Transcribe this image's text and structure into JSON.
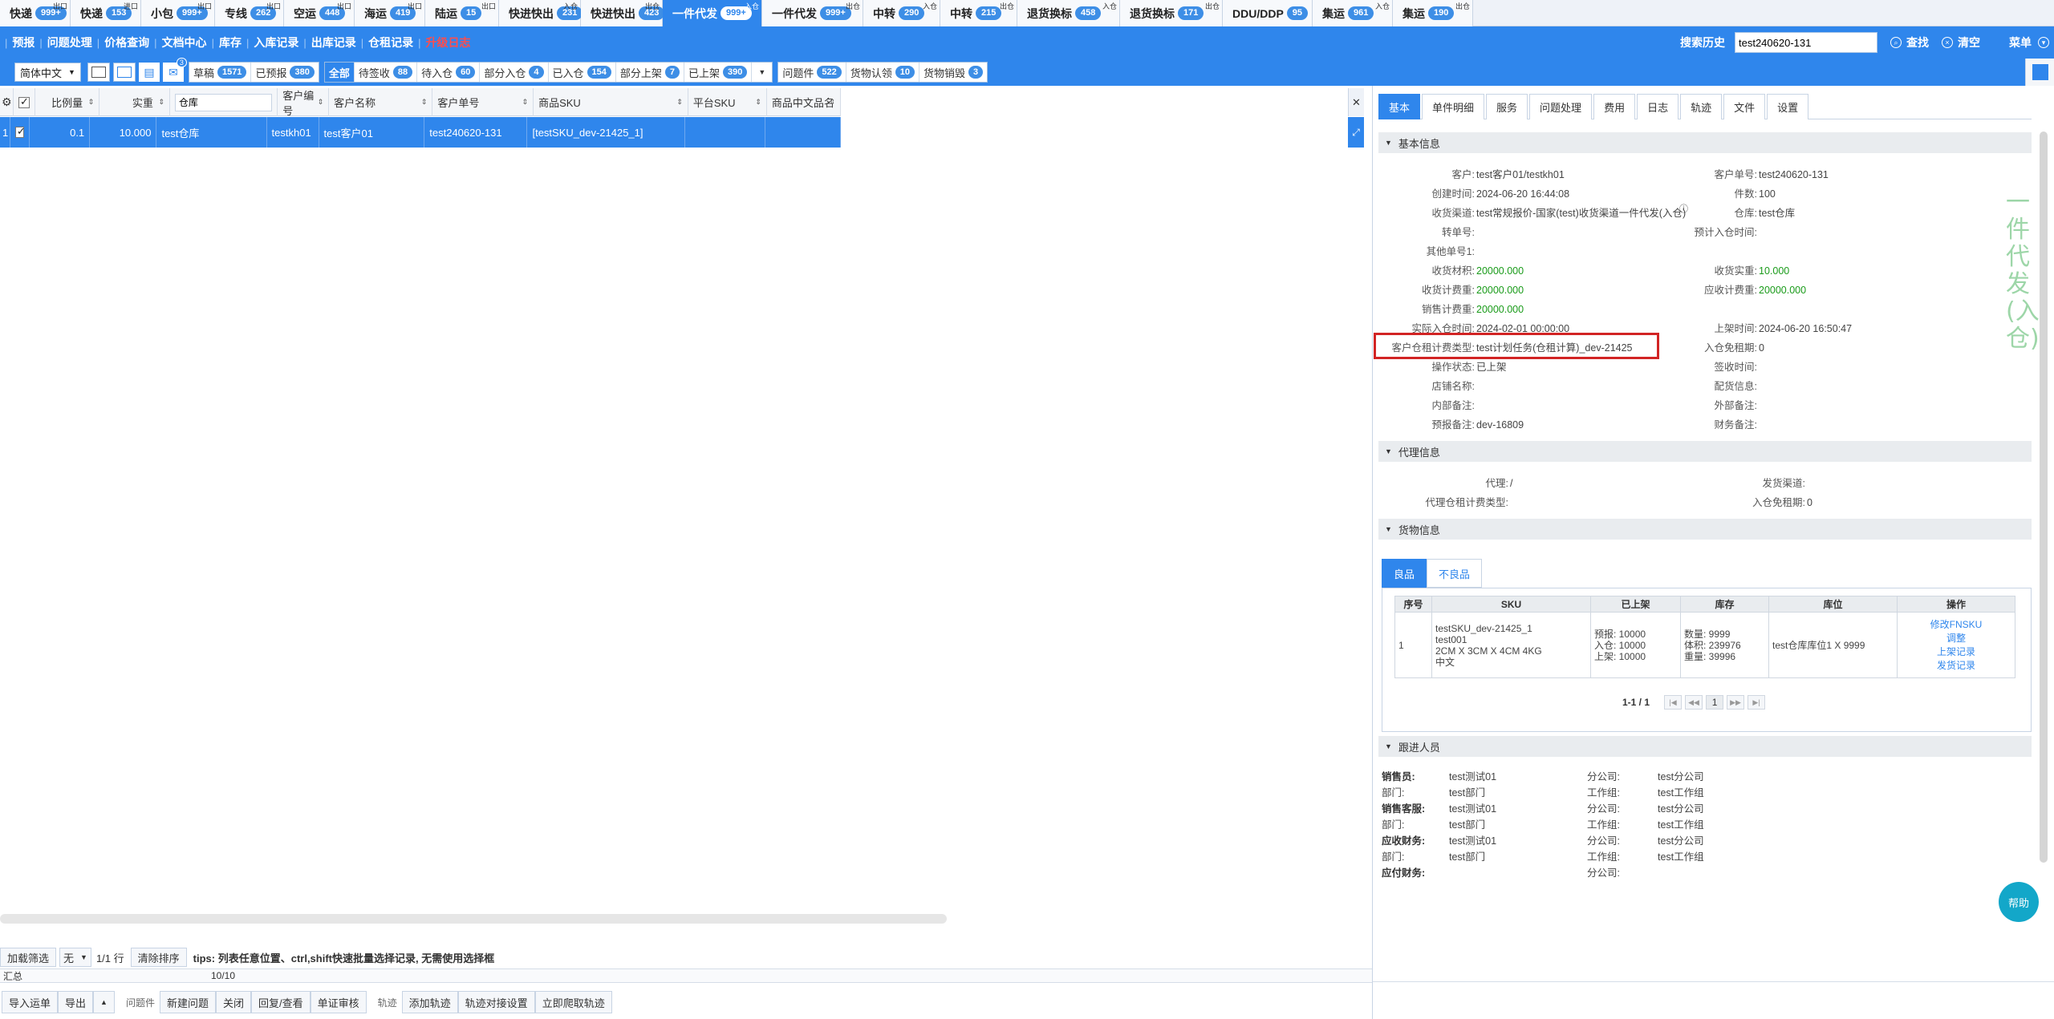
{
  "top_tabs": [
    {
      "label": "快递",
      "badge": "999+",
      "corner": "出口",
      "width": 88
    },
    {
      "label": "快递",
      "badge": "153",
      "corner": "进口",
      "width": 88
    },
    {
      "label": "小包",
      "badge": "999+",
      "corner": "出口",
      "width": 92
    },
    {
      "label": "专线",
      "badge": "262",
      "corner": "出口",
      "width": 86
    },
    {
      "label": "空运",
      "badge": "448",
      "corner": "出口",
      "width": 88
    },
    {
      "label": "海运",
      "badge": "419",
      "corner": "出口",
      "width": 88
    },
    {
      "label": "陆运",
      "badge": "15",
      "corner": "出口",
      "width": 92
    },
    {
      "label": "快进快出",
      "badge": "231",
      "corner": "入仓",
      "width": 102
    },
    {
      "label": "快进快出",
      "badge": "423",
      "corner": "出仓",
      "width": 102
    },
    {
      "label": "一件代发",
      "badge": "999+",
      "corner": "入仓",
      "width": 124,
      "active": true
    },
    {
      "label": "一件代发",
      "badge": "999+",
      "corner": "出仓",
      "width": 126
    },
    {
      "label": "中转",
      "badge": "290",
      "corner": "入仓",
      "width": 96
    },
    {
      "label": "中转",
      "badge": "215",
      "corner": "出仓",
      "width": 96
    },
    {
      "label": "退货换标",
      "badge": "458",
      "corner": "入仓",
      "width": 128
    },
    {
      "label": "退货换标",
      "badge": "171",
      "corner": "出仓",
      "width": 128
    },
    {
      "label": "DDU/DDP",
      "badge": "95",
      "corner": "",
      "width": 112
    },
    {
      "label": "集运",
      "badge": "961",
      "corner": "入仓",
      "width": 100
    },
    {
      "label": "集运",
      "badge": "190",
      "corner": "出仓",
      "width": 100
    }
  ],
  "nav": {
    "items": [
      "预报",
      "问题处理",
      "价格查询",
      "文档中心",
      "库存",
      "入库记录",
      "出库记录",
      "仓租记录"
    ],
    "red_item": "升级日志",
    "search_history": "搜索历史",
    "search_value": "test240620-131",
    "search": "查找",
    "clear": "清空",
    "menu": "菜单"
  },
  "filterbar": {
    "language": "简体中文",
    "mail_badge": "3",
    "group1": [
      {
        "label": "草稿",
        "badge": "1571"
      },
      {
        "label": "已预报",
        "badge": "380"
      }
    ],
    "all": "全部",
    "group2": [
      {
        "label": "待签收",
        "badge": "88"
      },
      {
        "label": "待入仓",
        "badge": "60"
      },
      {
        "label": "部分入仓",
        "badge": "4"
      },
      {
        "label": "已入仓",
        "badge": "154"
      },
      {
        "label": "部分上架",
        "badge": "7"
      },
      {
        "label": "已上架",
        "badge": "390"
      }
    ],
    "group3": [
      {
        "label": "问题件",
        "badge": "522"
      },
      {
        "label": "货物认领",
        "badge": "10"
      },
      {
        "label": "货物销毁",
        "badge": "3"
      }
    ]
  },
  "grid": {
    "headers": [
      "比例量",
      "实重",
      "仓库",
      "客户编号",
      "客户名称",
      "客户单号",
      "商品SKU",
      "平台SKU",
      "商品中文品名"
    ],
    "row": {
      "index": "1",
      "ratio": "0.1",
      "weight": "10.000",
      "warehouse": "test仓库",
      "cust_no": "testkh01",
      "cust_name": "test客户01",
      "cust_order": "test240620-131",
      "sku": "[testSKU_dev-21425_1]",
      "platform_sku": "",
      "cn_name": ""
    }
  },
  "pager": {
    "load_filter": "加载筛选",
    "none_option": "无",
    "rows": "1/1 行",
    "clear_sort": "清除排序",
    "tips": "tips: 列表任意位置、ctrl,shift快速批量选择记录, 无需使用选择框",
    "sum_label": "汇总",
    "sum_count": "10/10"
  },
  "bottom": {
    "import": "导入运单",
    "export": "导出",
    "problem_label": "问题件",
    "new_problem": "新建问题",
    "close": "关闭",
    "reply": "回复/查看",
    "audit": "单证审核",
    "track_label": "轨迹",
    "add_track": "添加轨迹",
    "track_setting": "轨迹对接设置",
    "fetch_track": "立即爬取轨迹"
  },
  "detail": {
    "tabs": [
      "基本",
      "单件明细",
      "服务",
      "问题处理",
      "费用",
      "日志",
      "轨迹",
      "文件",
      "设置"
    ],
    "basic_title": "基本信息",
    "vertical_label": "一件代发(入仓)",
    "left": [
      {
        "k": "客户:",
        "v": "test客户01/testkh01"
      },
      {
        "k": "创建时间:",
        "v": "2024-06-20 16:44:08"
      },
      {
        "k": "收货渠道:",
        "v": "test常规报价-国家(test)收货渠道一件代发(入仓)"
      },
      {
        "k": "转单号:",
        "v": ""
      },
      {
        "k": "其他单号1:",
        "v": ""
      },
      {
        "k": "收货材积:",
        "v": "20000.000",
        "green": true
      },
      {
        "k": "收货计费重:",
        "v": "20000.000",
        "green": true
      },
      {
        "k": "销售计费重:",
        "v": "20000.000",
        "green": true
      },
      {
        "k": "实际入仓时间:",
        "v": "2024-02-01 00:00:00"
      },
      {
        "k": "客户仓租计费类型:",
        "v": "test计划任务(仓租计算)_dev-21425"
      },
      {
        "k": "操作状态:",
        "v": "已上架"
      },
      {
        "k": "店铺名称:",
        "v": ""
      },
      {
        "k": "内部备注:",
        "v": ""
      },
      {
        "k": "预报备注:",
        "v": "dev-16809"
      }
    ],
    "right": [
      {
        "k": "客户单号:",
        "v": "test240620-131"
      },
      {
        "k": "件数:",
        "v": "100"
      },
      {
        "k": "仓库:",
        "v": "test仓库"
      },
      {
        "k": "预计入仓时间:",
        "v": ""
      },
      {
        "k": "",
        "v": ""
      },
      {
        "k": "收货实重:",
        "v": "10.000",
        "green": true
      },
      {
        "k": "应收计费重:",
        "v": "20000.000",
        "green": true
      },
      {
        "k": "",
        "v": ""
      },
      {
        "k": "上架时间:",
        "v": "2024-06-20 16:50:47"
      },
      {
        "k": "入仓免租期:",
        "v": "0"
      },
      {
        "k": "签收时间:",
        "v": ""
      },
      {
        "k": "配货信息:",
        "v": ""
      },
      {
        "k": "外部备注:",
        "v": ""
      },
      {
        "k": "财务备注:",
        "v": ""
      }
    ],
    "agent_title": "代理信息",
    "agent": {
      "agent_k": "代理:",
      "agent_v": "/",
      "send_k": "发货渠道:",
      "send_v": "",
      "fee_k": "代理仓租计费类型:",
      "fee_v": "",
      "free_k": "入仓免租期:",
      "free_v": "0"
    },
    "goods_title": "货物信息",
    "goods_tabs": [
      "良品",
      "不良品"
    ],
    "goods_headers": [
      "序号",
      "SKU",
      "已上架",
      "库存",
      "库位",
      "操作"
    ],
    "goods_row": {
      "no": "1",
      "sku_lines": [
        "testSKU_dev-21425_1",
        "test001",
        "2CM X 3CM X 4CM 4KG",
        "中文"
      ],
      "shelf_lines": [
        "预报:  10000",
        "入仓:  10000",
        "上架:  10000"
      ],
      "stock_lines": [
        "数量:  9999",
        "体积:  239976",
        "重量:  39996"
      ],
      "location": "test仓库库位1 X 9999",
      "ops": [
        "修改FNSKU",
        "调整",
        "上架记录",
        "发货记录"
      ]
    },
    "goods_pager": {
      "range": "1-1 / 1",
      "page": "1"
    },
    "staff_title": "跟进人员",
    "staff": [
      {
        "role": "销售员:",
        "name": "test测试01",
        "sub_k": "分公司:",
        "sub_v": "test分公司"
      },
      {
        "role": "部门:",
        "name": "test部门",
        "sub_k": "工作组:",
        "sub_v": "test工作组"
      },
      {
        "role": "销售客服:",
        "name": "test测试01",
        "sub_k": "分公司:",
        "sub_v": "test分公司"
      },
      {
        "role": "部门:",
        "name": "test部门",
        "sub_k": "工作组:",
        "sub_v": "test工作组"
      },
      {
        "role": "应收财务:",
        "name": "test测试01",
        "sub_k": "分公司:",
        "sub_v": "test分公司"
      },
      {
        "role": "部门:",
        "name": "test部门",
        "sub_k": "工作组:",
        "sub_v": "test工作组"
      },
      {
        "role": "应付财务:",
        "name": "",
        "sub_k": "分公司:",
        "sub_v": ""
      }
    ],
    "help": "帮助"
  }
}
